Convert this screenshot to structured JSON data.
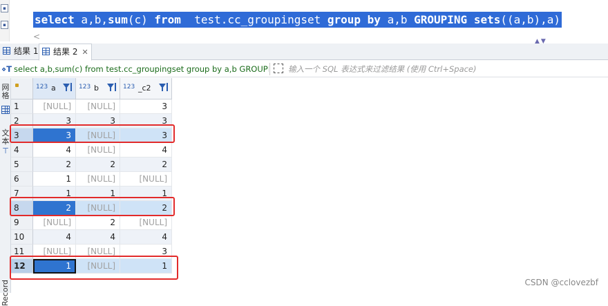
{
  "editor": {
    "sql_keyword_select": "select",
    "sql_cols": " a,b,",
    "sql_func": "sum",
    "sql_arg": "(c) ",
    "sql_keyword_from": "from",
    "sql_table": "  test.cc_groupingset ",
    "sql_keyword_group": "group",
    "sql_space1": " ",
    "sql_keyword_by": "by",
    "sql_by_cols": " a,b ",
    "sql_keyword_grouping": "GROUPING",
    "sql_space2": " ",
    "sql_keyword_sets": "sets",
    "sql_sets_args": "((a,b),a)"
  },
  "tabs": [
    {
      "label": "结果 1",
      "active": false
    },
    {
      "label": "结果 2",
      "active": true
    }
  ],
  "query_bar": {
    "query_text": "select a,b,sum(c) from test.cc_groupingset group by a,b GROUPING sets((a,b),a)",
    "filter_placeholder": "输入一个 SQL 表达式来过滤结果 (使用 Ctrl+Space)"
  },
  "side_panel": {
    "grid_label": "网格",
    "text_label": "文本",
    "record_label": "Record"
  },
  "grid": {
    "columns": [
      {
        "type": "123",
        "name": "a"
      },
      {
        "type": "123",
        "name": "b"
      },
      {
        "type": "123",
        "name": "_c2"
      }
    ],
    "rows": [
      {
        "num": "1",
        "a": "[NULL]",
        "b": "[NULL]",
        "c2": "3"
      },
      {
        "num": "2",
        "a": "3",
        "b": "3",
        "c2": "3"
      },
      {
        "num": "3",
        "a": "3",
        "b": "[NULL]",
        "c2": "3"
      },
      {
        "num": "4",
        "a": "4",
        "b": "[NULL]",
        "c2": "4"
      },
      {
        "num": "5",
        "a": "2",
        "b": "2",
        "c2": "2"
      },
      {
        "num": "6",
        "a": "1",
        "b": "[NULL]",
        "c2": "[NULL]"
      },
      {
        "num": "7",
        "a": "1",
        "b": "1",
        "c2": "1"
      },
      {
        "num": "8",
        "a": "2",
        "b": "[NULL]",
        "c2": "2"
      },
      {
        "num": "9",
        "a": "[NULL]",
        "b": "2",
        "c2": "[NULL]"
      },
      {
        "num": "10",
        "a": "4",
        "b": "4",
        "c2": "4"
      },
      {
        "num": "11",
        "a": "[NULL]",
        "b": "[NULL]",
        "c2": "3"
      },
      {
        "num": "12",
        "a": "1",
        "b": "[NULL]",
        "c2": "1"
      }
    ]
  },
  "watermark": "CSDN @cclovezbf",
  "colors": {
    "editor_selection": "#2f6bd7",
    "highlight_box": "#e22a2a",
    "selected_cell": "#2f74d0",
    "query_text": "#1a6b1a"
  }
}
